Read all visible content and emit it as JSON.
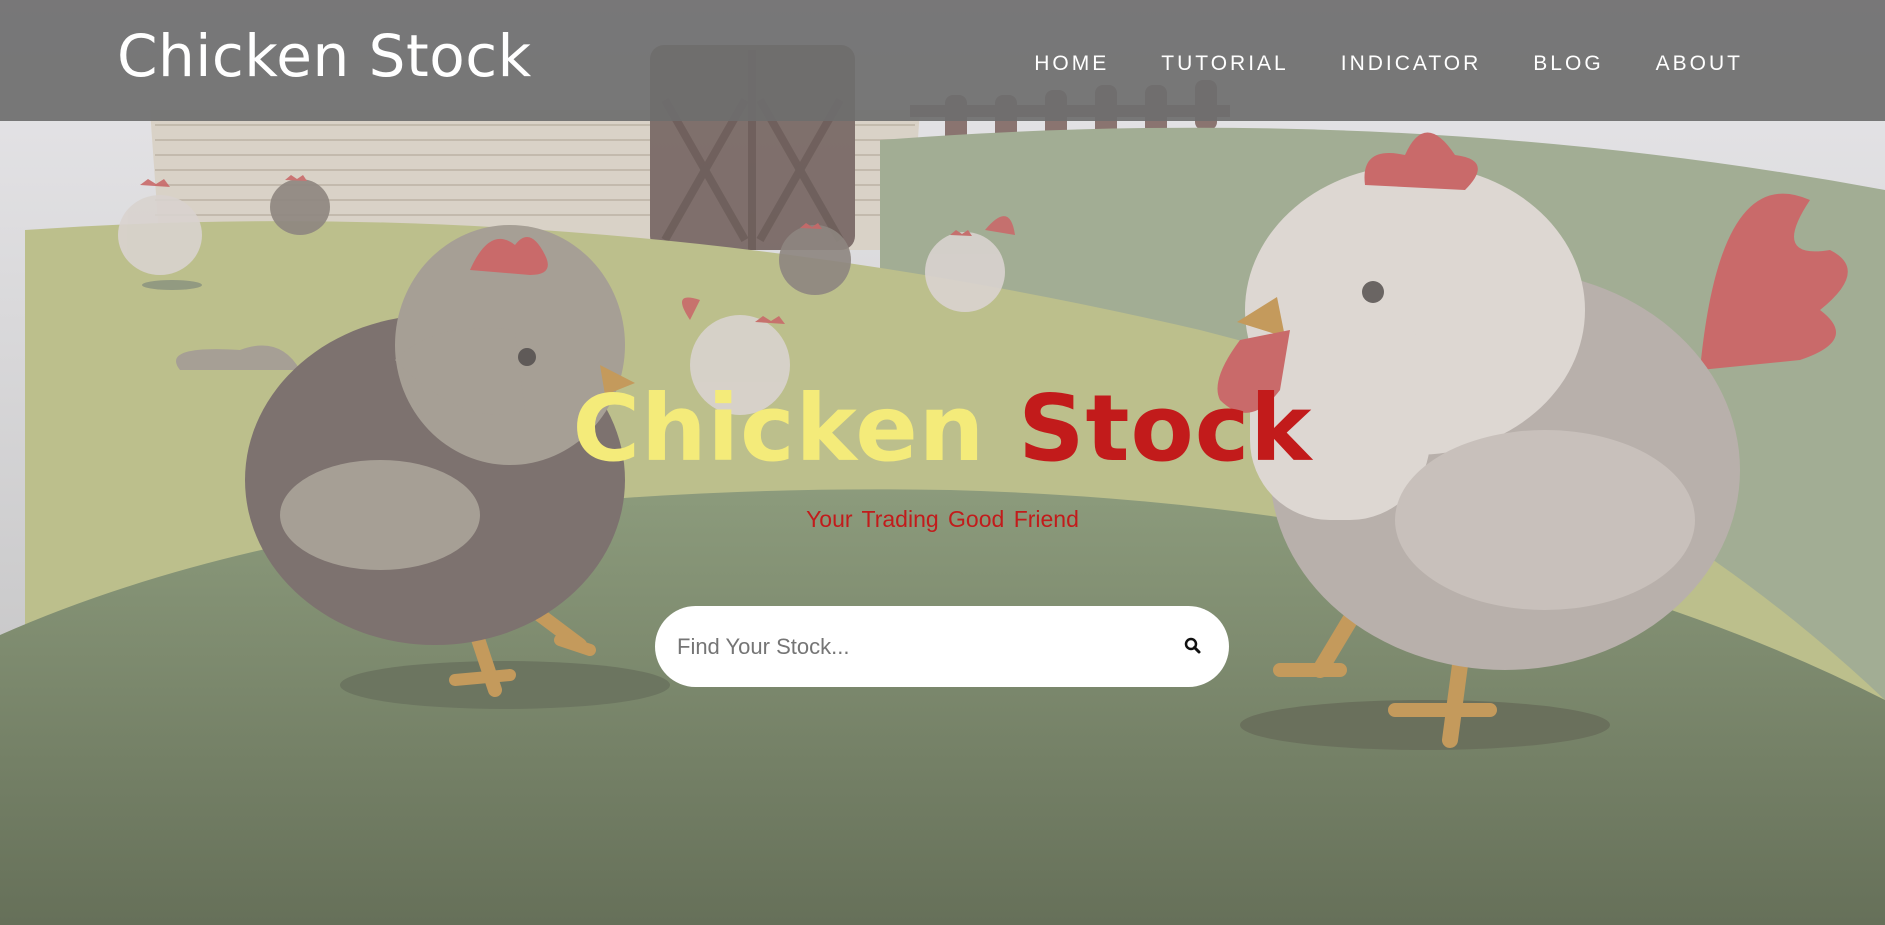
{
  "header": {
    "brand": "Chicken Stock",
    "nav": [
      "HOME",
      "TUTORIAL",
      "INDICATOR",
      "BLOG",
      "ABOUT"
    ]
  },
  "hero": {
    "title_word_1": "Chicken",
    "title_word_2": "Stock",
    "tagline": "Your Trading Good Friend"
  },
  "search": {
    "placeholder": "Find Your Stock...",
    "icon": "search-icon"
  },
  "colors": {
    "title_yellow": "#f4eb7a",
    "title_red": "#c21b1b",
    "navbar": "#6e6e6e"
  }
}
